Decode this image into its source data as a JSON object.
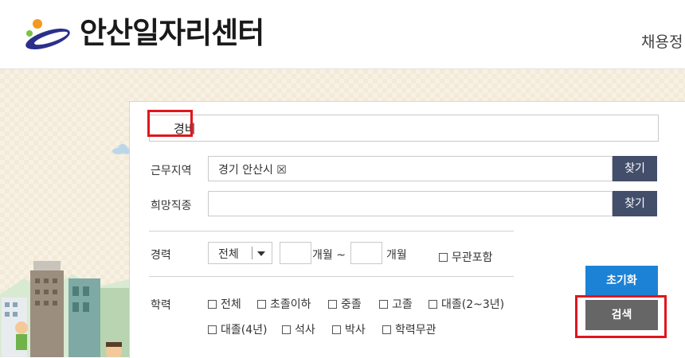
{
  "header": {
    "site_title": "안산일자리센터",
    "nav_partial": "채용정",
    "logo_icon": "ansan-logo-icon"
  },
  "search": {
    "keyword_value": "경비",
    "region_label": "근무지역",
    "region_value": "경기 안산시 ☒",
    "region_find": "찾기",
    "job_label": "희망직종",
    "job_value": "",
    "job_find": "찾기",
    "career_label": "경력",
    "career_select": "전체",
    "career_from_unit": "개월 ~",
    "career_to_unit": "개월",
    "career_any": "무관포함",
    "edu_label": "학력",
    "edu_options": [
      "전체",
      "초졸이하",
      "중졸",
      "고졸",
      "대졸(2~3년)",
      "대졸(4년)",
      "석사",
      "박사",
      "학력무관"
    ],
    "reset_label": "초기화",
    "search_label": "검색"
  },
  "colors": {
    "find_btn": "#434e6b",
    "reset_btn": "#1c82d5",
    "search_btn": "#666666",
    "highlight": "#e0161e",
    "background": "#f3ead7"
  }
}
